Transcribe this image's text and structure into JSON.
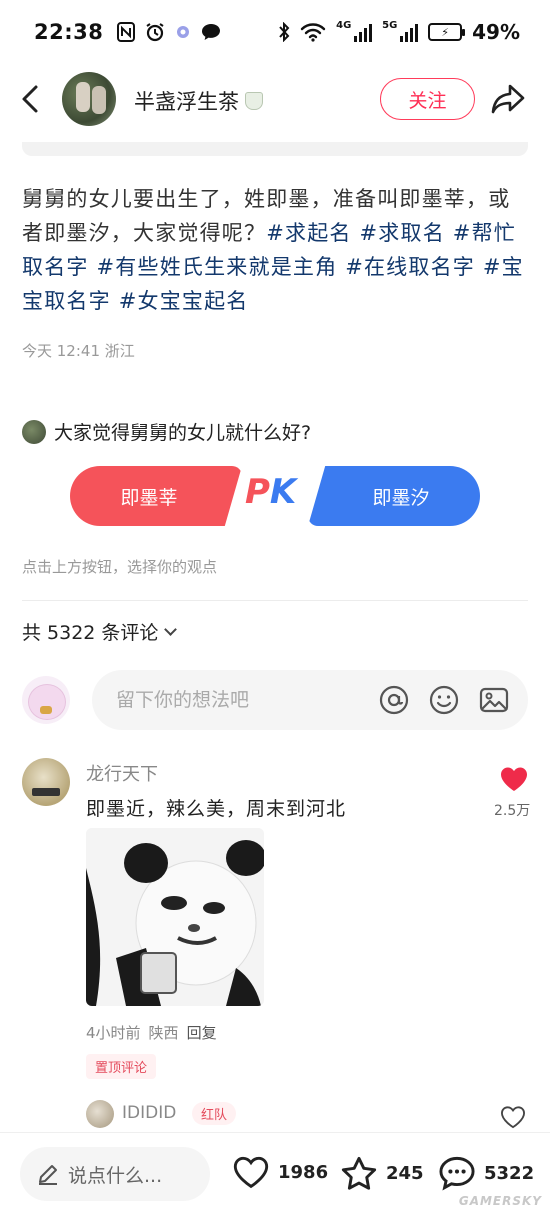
{
  "status_bar": {
    "time": "22:38",
    "left_icons": [
      "nfc-icon",
      "alarm-icon",
      "app-icon",
      "message-icon"
    ],
    "network_1": "4G",
    "network_2": "5G",
    "battery_percent": "49%"
  },
  "header": {
    "username": "半盏浮生茶",
    "follow_label": "关注"
  },
  "post": {
    "text_plain": "舅舅的女儿要出生了，姓即墨，准备叫即墨莘，或者即墨汐，大家觉得呢？",
    "tags": [
      "#求起名",
      "#求取名",
      "#帮忙取名字",
      "#有些姓氏生来就是主角",
      "#在线取名字",
      "#宝宝取名字",
      "#女宝宝起名"
    ],
    "meta": "今天 12:41 浙江"
  },
  "vote": {
    "question": "大家觉得舅舅的女儿就什么好?",
    "option_left": "即墨莘",
    "option_right": "即墨汐",
    "pk_p": "P",
    "pk_k": "K",
    "hint": "点击上方按钮，选择你的观点"
  },
  "comments": {
    "count_label": "共 5322 条评论",
    "input_placeholder": "留下你的想法吧",
    "first": {
      "author": "龙行天下",
      "text": "即墨近，辣么美，周末到河北",
      "likes": "2.5万",
      "time": "4小时前",
      "location": "陕西",
      "reply_label": "回复",
      "pinned_label": "置顶评论"
    },
    "reply": {
      "author": "IDIDID",
      "team_badge": "红队"
    }
  },
  "bottom_bar": {
    "placeholder": "说点什么...",
    "likes": "1986",
    "favorites": "245",
    "comments": "5322",
    "watermark": "GAMERSKY"
  },
  "colors": {
    "accent_red": "#ff2e55",
    "pk_red": "#f5535a",
    "pk_blue": "#3b7bf0",
    "tag_blue": "#13386c"
  }
}
